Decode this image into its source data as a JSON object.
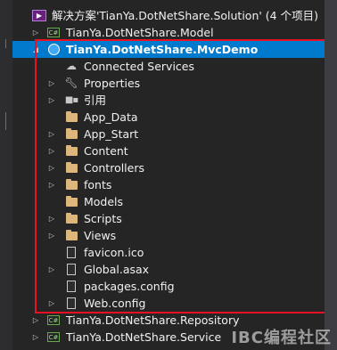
{
  "solution": {
    "label": "解决方案'TianYa.DotNetShare.Solution' (4 个项目)"
  },
  "projects": {
    "model": "TianYa.DotNetShare.Model",
    "mvc": "TianYa.DotNetShare.MvcDemo",
    "repository": "TianYa.DotNetShare.Repository",
    "service": "TianYa.DotNetShare.Service"
  },
  "icons": {
    "csharp": "C#",
    "vs": "▶"
  },
  "mvc_items": [
    {
      "label": "Connected Services",
      "icon": "cloud-icon"
    },
    {
      "label": "Properties",
      "icon": "wrench-icon"
    },
    {
      "label": "引用",
      "icon": "references-icon"
    },
    {
      "label": "App_Data",
      "icon": "folder-icon"
    },
    {
      "label": "App_Start",
      "icon": "folder-icon"
    },
    {
      "label": "Content",
      "icon": "folder-icon"
    },
    {
      "label": "Controllers",
      "icon": "folder-icon"
    },
    {
      "label": "fonts",
      "icon": "folder-icon"
    },
    {
      "label": "Models",
      "icon": "folder-icon"
    },
    {
      "label": "Scripts",
      "icon": "folder-icon"
    },
    {
      "label": "Views",
      "icon": "folder-icon"
    },
    {
      "label": "favicon.ico",
      "icon": "file-icon"
    },
    {
      "label": "Global.asax",
      "icon": "file-icon"
    },
    {
      "label": "packages.config",
      "icon": "file-icon"
    },
    {
      "label": "Web.config",
      "icon": "file-icon"
    }
  ],
  "watermark": "IBC编程社区",
  "colors": {
    "selection": "#007acc",
    "highlight_box": "#e81123",
    "background": "#252526"
  }
}
